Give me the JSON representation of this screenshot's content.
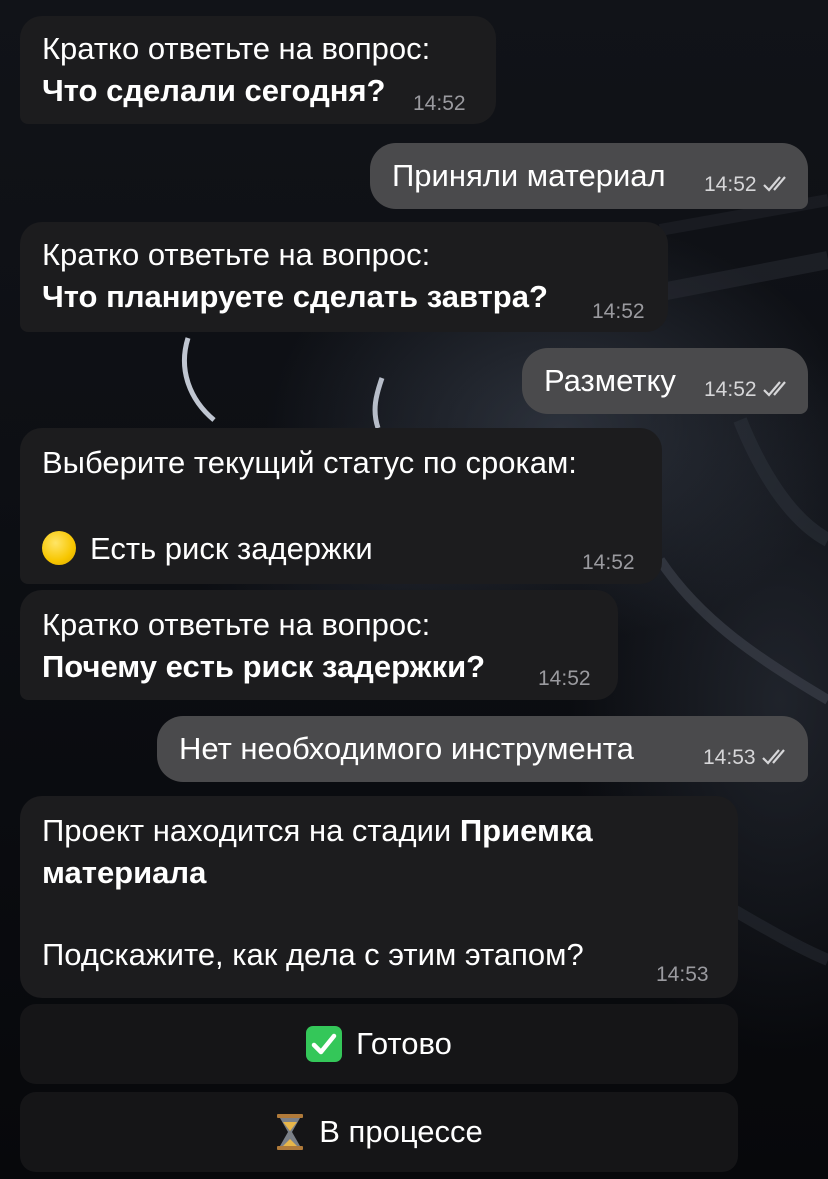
{
  "messages": [
    {
      "line1": "Кратко ответьте на вопрос:",
      "line2": "Что сделали сегодня?",
      "time": "14:52"
    },
    {
      "text": "Приняли материал",
      "time": "14:52"
    },
    {
      "line1": "Кратко ответьте на вопрос:",
      "line2": "Что планируете сделать завтра?",
      "time": "14:52"
    },
    {
      "text": "Разметку",
      "time": "14:52"
    },
    {
      "line1": "Выберите текущий статус по срокам:",
      "line3": "Есть риск задержки",
      "time": "14:52",
      "status_icon": "yellow-circle-icon"
    },
    {
      "line1": "Кратко ответьте на вопрос:",
      "line2": "Почему есть риск задержки?",
      "time": "14:52"
    },
    {
      "text": "Нет необходимого инструмента",
      "time": "14:53"
    },
    {
      "line1_regular": "Проект находится на стадии ",
      "line1_bold": "Приемка",
      "line2_bold": "материала",
      "line3": "Подскажите, как дела с этим этапом?",
      "time": "14:53"
    }
  ],
  "keyboard": [
    {
      "label": "Готово",
      "icon": "check-mark-button-icon"
    },
    {
      "label": "В процессе",
      "icon": "hourglass-icon"
    }
  ],
  "colors": {
    "incoming_bubble": "#1c1c1e",
    "outgoing_bubble": "#4a4a4c",
    "time_text": "#9a9a9f",
    "status_yellow": "#f7c600",
    "check_green": "#34c759"
  }
}
